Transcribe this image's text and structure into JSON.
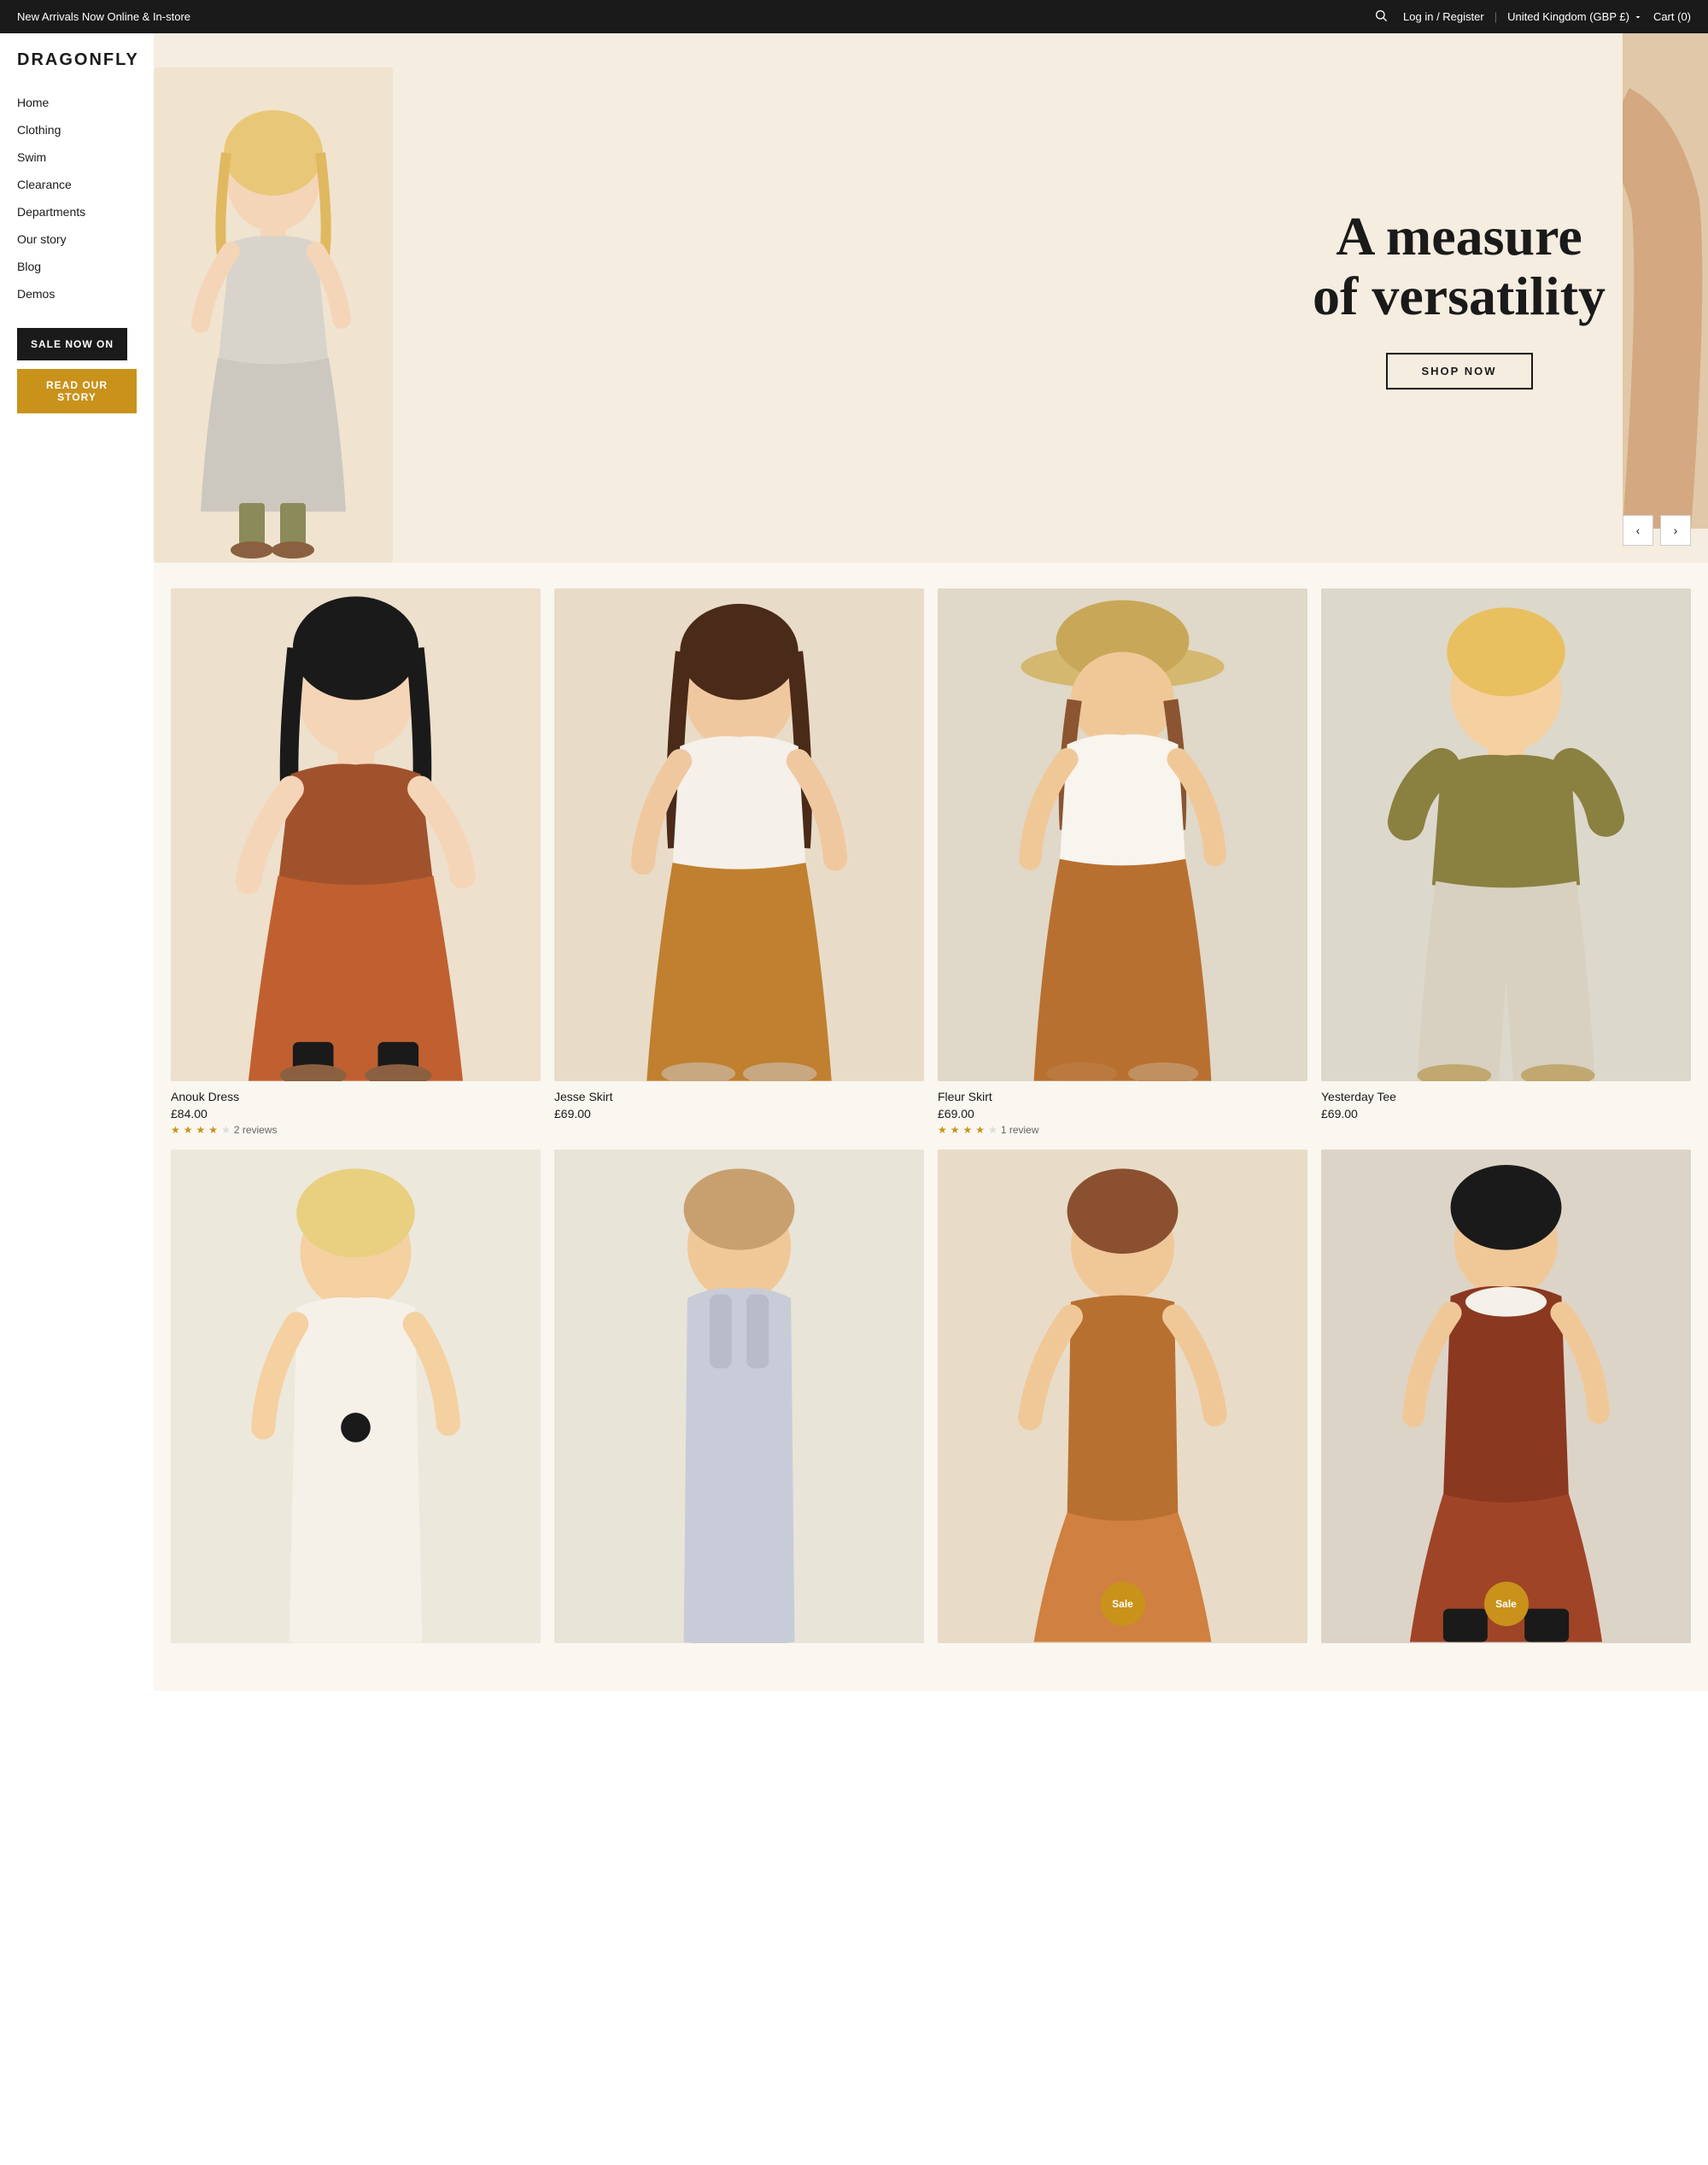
{
  "announcement": {
    "text": "New Arrivals Now Online & In-store",
    "login_label": "Log in / Register",
    "currency_label": "United Kingdom (GBP £)",
    "cart_label": "Cart (0)"
  },
  "sidebar": {
    "logo": "DRAGONFLY",
    "nav_items": [
      {
        "label": "Home",
        "href": "#"
      },
      {
        "label": "Clothing",
        "href": "#"
      },
      {
        "label": "Swim",
        "href": "#"
      },
      {
        "label": "Clearance",
        "href": "#"
      },
      {
        "label": "Departments",
        "href": "#"
      },
      {
        "label": "Our story",
        "href": "#"
      },
      {
        "label": "Blog",
        "href": "#"
      },
      {
        "label": "Demos",
        "href": "#"
      }
    ],
    "btn_sale": "SALE NOW ON",
    "btn_story": "READ OUR STORY"
  },
  "hero": {
    "title_line1": "A measure",
    "title_line2": "of versatility",
    "shop_btn": "SHOP NOW",
    "prev_arrow": "‹",
    "next_arrow": "›"
  },
  "products": {
    "row1": [
      {
        "name": "Anouk Dress",
        "price": "£84.00",
        "stars": 4,
        "max_stars": 5,
        "reviews": "2 reviews",
        "sale": false,
        "bg": "#ede0cc"
      },
      {
        "name": "Jesse Skirt",
        "price": "£69.00",
        "stars": 0,
        "max_stars": 5,
        "reviews": "",
        "sale": false,
        "bg": "#e8dcc8"
      },
      {
        "name": "Fleur Skirt",
        "price": "£69.00",
        "stars": 4,
        "max_stars": 5,
        "reviews": "1 review",
        "sale": false,
        "bg": "#e0d8c8"
      },
      {
        "name": "Yesterday Tee",
        "price": "£69.00",
        "stars": 0,
        "max_stars": 5,
        "reviews": "",
        "sale": false,
        "bg": "#dcd8cc"
      }
    ],
    "row2": [
      {
        "name": "",
        "price": "",
        "stars": 0,
        "reviews": "",
        "sale": false,
        "bg": "#ece8dc"
      },
      {
        "name": "",
        "price": "",
        "stars": 0,
        "reviews": "",
        "sale": false,
        "bg": "#e8e4d8"
      },
      {
        "name": "",
        "price": "",
        "stars": 0,
        "reviews": "",
        "sale": true,
        "bg": "#e8dcc8"
      },
      {
        "name": "",
        "price": "",
        "stars": 0,
        "reviews": "",
        "sale": true,
        "bg": "#ddd4c8"
      }
    ],
    "sale_badge_label": "Sale"
  }
}
